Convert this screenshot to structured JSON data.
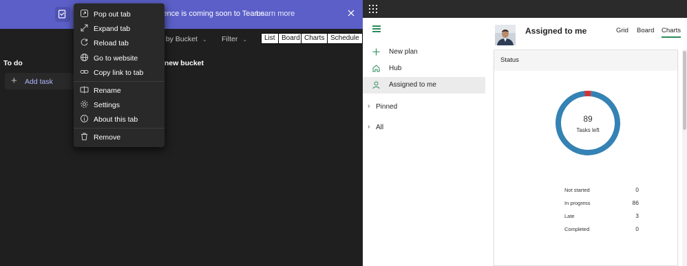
{
  "teams": {
    "banner": {
      "text": "ience is coming soon to Teams.",
      "link": "Learn more"
    },
    "toolbar": {
      "group_by": "p by Bucket",
      "filter": "Filter",
      "views": [
        "List",
        "Board",
        "Charts",
        "Schedule"
      ]
    },
    "buckets": {
      "todo_title": "To do",
      "add_task": "Add task",
      "new_bucket": "l new bucket"
    },
    "context_menu": {
      "items": [
        {
          "label": "Pop out tab",
          "icon": "pop-out-icon"
        },
        {
          "label": "Expand tab",
          "icon": "expand-icon"
        },
        {
          "label": "Reload tab",
          "icon": "reload-icon"
        },
        {
          "label": "Go to website",
          "icon": "globe-icon"
        },
        {
          "label": "Copy link to tab",
          "icon": "link-icon"
        },
        {
          "label": "Rename",
          "icon": "rename-icon"
        },
        {
          "label": "Settings",
          "icon": "gear-icon"
        },
        {
          "label": "About this tab",
          "icon": "info-icon"
        },
        {
          "label": "Remove",
          "icon": "trash-icon"
        }
      ]
    }
  },
  "planner": {
    "nav": {
      "items": [
        {
          "label": "New plan",
          "icon": "plus-icon"
        },
        {
          "label": "Hub",
          "icon": "home-icon"
        },
        {
          "label": "Assigned to me",
          "icon": "person-icon",
          "active": true
        }
      ],
      "sections": [
        "Pinned",
        "All"
      ]
    },
    "header": {
      "title": "Assigned to me",
      "tabs": [
        "Grid",
        "Board",
        "Charts"
      ],
      "active_tab": "Charts"
    },
    "status_card": {
      "title": "Status",
      "center_value": "89",
      "center_label": "Tasks left",
      "rows": [
        {
          "label": "Not started",
          "value": "0"
        },
        {
          "label": "In progress",
          "value": "86"
        },
        {
          "label": "Late",
          "value": "3"
        },
        {
          "label": "Completed",
          "value": "0"
        }
      ]
    }
  },
  "colors": {
    "teams_purple": "#5b5fc7",
    "planner_green": "#2a8a5a",
    "in_progress": "#3582b4",
    "late": "#d13438"
  }
}
